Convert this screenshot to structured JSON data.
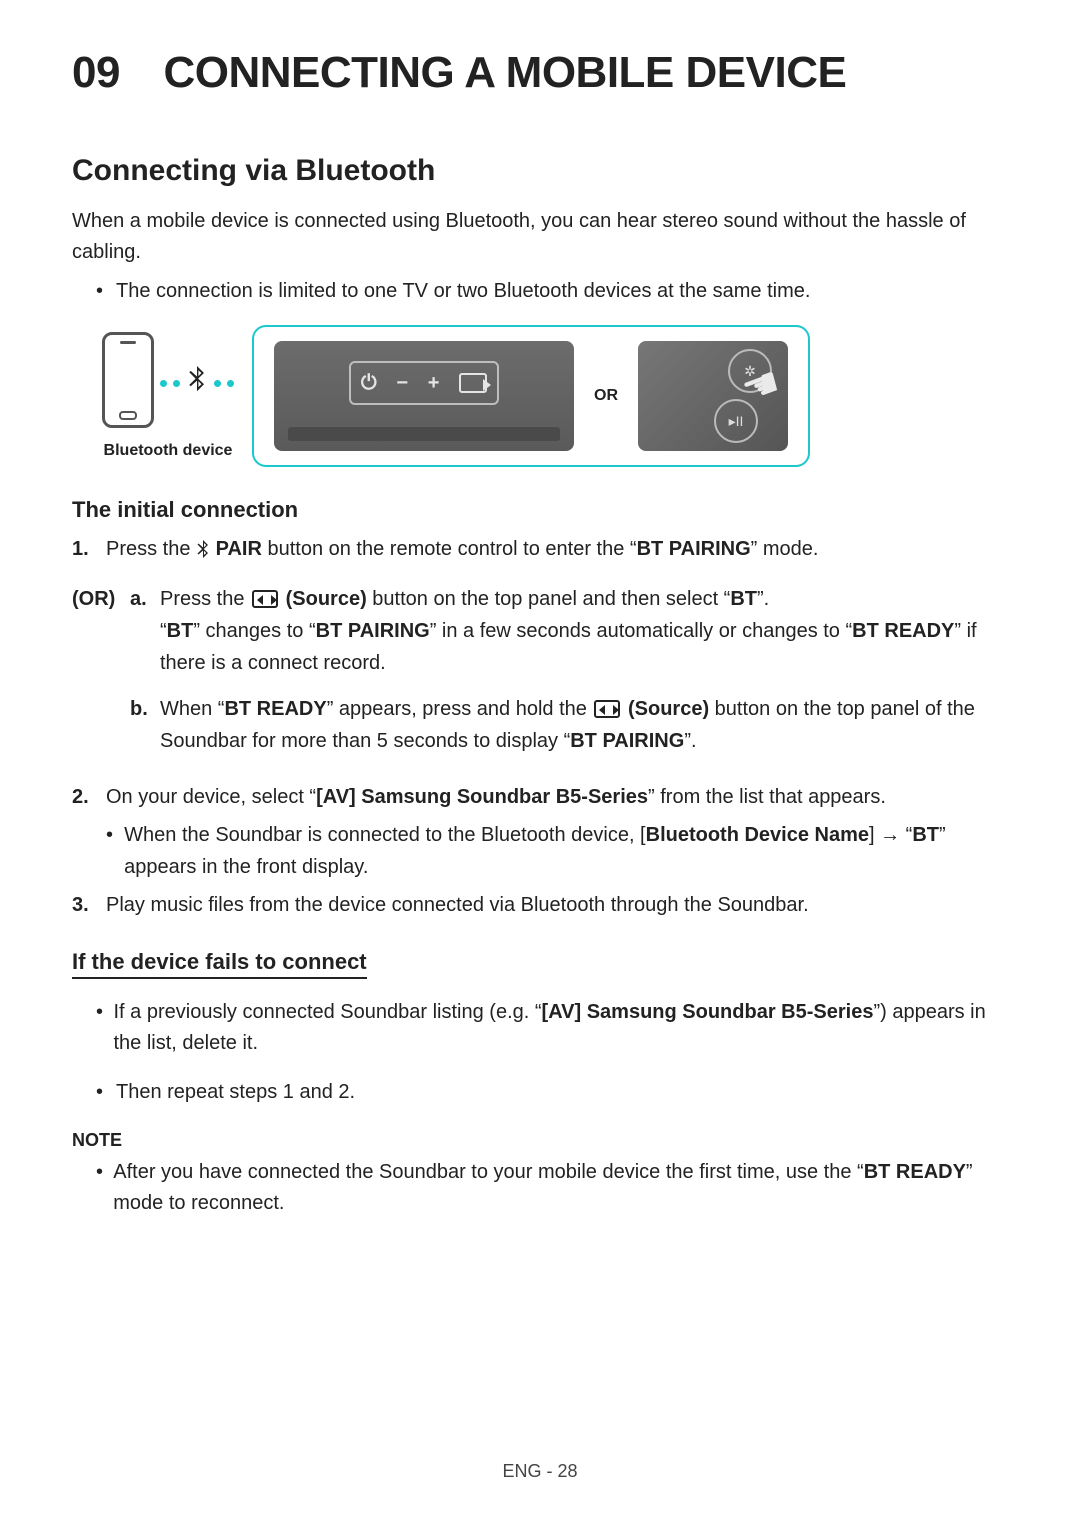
{
  "title": "09 CONNECTING A MOBILE DEVICE",
  "section": "Connecting via Bluetooth",
  "intro": "When a mobile device is connected using Bluetooth, you can hear stereo sound without the hassle of cabling.",
  "limitBullet": "The connection is limited to one TV or two Bluetooth devices at the same time.",
  "diagram": {
    "phoneLabel": "Bluetooth device",
    "orLabel": "OR",
    "btGlyph": "$",
    "panel": {
      "power": "⏻",
      "minus": "−",
      "plus": "+"
    }
  },
  "initial": {
    "heading": "The initial connection",
    "step1_num": "1.",
    "step1_a": "Press the ",
    "step1_bt": "$",
    "step1_pair": " PAIR",
    "step1_b": " button on the remote control to enter the “",
    "step1_mode": "BT PAIRING",
    "step1_c": "” mode.",
    "orLabel": "(OR)",
    "a_letter": "a.",
    "a_1": "Press the ",
    "a_src": " (Source)",
    "a_2": " button on the top panel and then select “",
    "a_bt": "BT",
    "a_3": "”.",
    "a_line2_1": "“",
    "a_line2_bt": "BT",
    "a_line2_2": "” changes to “",
    "a_line2_pair": "BT PAIRING",
    "a_line2_3": "” in a few seconds automatically or changes to “",
    "a_line2_ready": "BT READY",
    "a_line2_4": "” if there is a connect record.",
    "b_letter": "b.",
    "b_1": "When “",
    "b_ready": "BT READY",
    "b_2": "” appears, press and hold the ",
    "b_src": " (Source)",
    "b_3": " button on the top panel of the Soundbar for more than 5 seconds to display “",
    "b_pair": "BT PAIRING",
    "b_4": "”.",
    "step2_num": "2.",
    "step2_a": "On your device, select “",
    "step2_dev": "[AV] Samsung Soundbar B5-Series",
    "step2_b": "” from the list that appears.",
    "step2_bullet_a": "When the Soundbar is connected to the Bluetooth device, [",
    "step2_bullet_dev": "Bluetooth Device Name",
    "step2_bullet_b": "] → “",
    "step2_bullet_bt": "BT",
    "step2_bullet_c": "” appears in the front display.",
    "step3_num": "3.",
    "step3": "Play music files from the device connected via Bluetooth through the Soundbar."
  },
  "fail": {
    "heading": "If the device fails to connect",
    "b1_a": "If a previously connected Soundbar listing (e.g. “",
    "b1_dev": "[AV] Samsung Soundbar B5-Series",
    "b1_b": "”) appears in the list, delete it.",
    "b2": "Then repeat steps 1 and 2."
  },
  "note": {
    "heading": "NOTE",
    "b1_a": "After you have connected the Soundbar to your mobile device the first time, use the “",
    "b1_ready": "BT READY",
    "b1_b": "” mode to reconnect."
  },
  "footer": "ENG - 28"
}
